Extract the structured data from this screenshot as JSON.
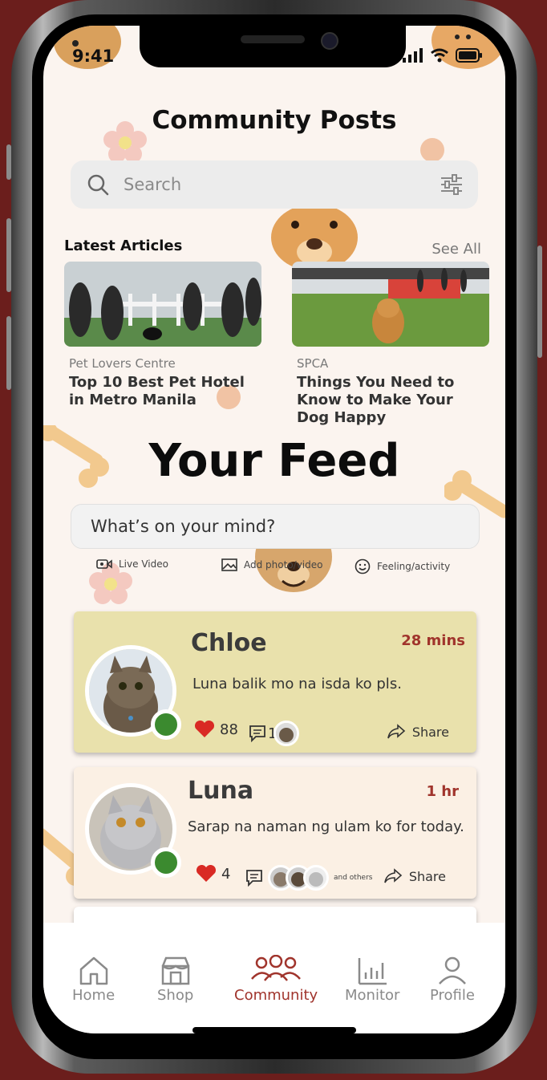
{
  "status": {
    "time": "9:41"
  },
  "header": {
    "title": "Community Posts"
  },
  "search": {
    "placeholder": "Search",
    "icon": "search-icon",
    "filter_icon": "filter-icon"
  },
  "articles": {
    "section_title": "Latest Articles",
    "see_all": "See All",
    "items": [
      {
        "source": "Pet Lovers Centre",
        "title": "Top 10 Best Pet Hotel in Metro Manila"
      },
      {
        "source": "SPCA",
        "title": "Things You Need to Know to Make Your Dog Happy"
      }
    ]
  },
  "feed": {
    "title": "Your Feed",
    "composer_placeholder": "What’s on your mind?",
    "actions": [
      "Live Video",
      "Add photo/video",
      "Feeling/activity"
    ]
  },
  "posts": [
    {
      "name": "Chloe",
      "time": "28 mins",
      "text": "Luna balik mo na isda ko pls.",
      "likes": "88",
      "comments": "1",
      "share": "Share",
      "bg": "#e9e1ac"
    },
    {
      "name": "Luna",
      "time": "1 hr",
      "text": "Sarap na naman ng ulam ko for today.",
      "likes": "4",
      "comments_label": "and others",
      "share": "Share",
      "bg": "#fbf0e4"
    }
  ],
  "tabbar": {
    "items": [
      {
        "label": "Home",
        "icon": "home-icon"
      },
      {
        "label": "Shop",
        "icon": "shop-icon"
      },
      {
        "label": "Community",
        "icon": "community-icon",
        "active": true
      },
      {
        "label": "Monitor",
        "icon": "monitor-icon"
      },
      {
        "label": "Profile",
        "icon": "profile-icon"
      }
    ]
  },
  "colors": {
    "accent": "#a0342c",
    "online": "#3b8a2f",
    "background": "#fbf4ef",
    "frame": "#6b1e1c"
  }
}
